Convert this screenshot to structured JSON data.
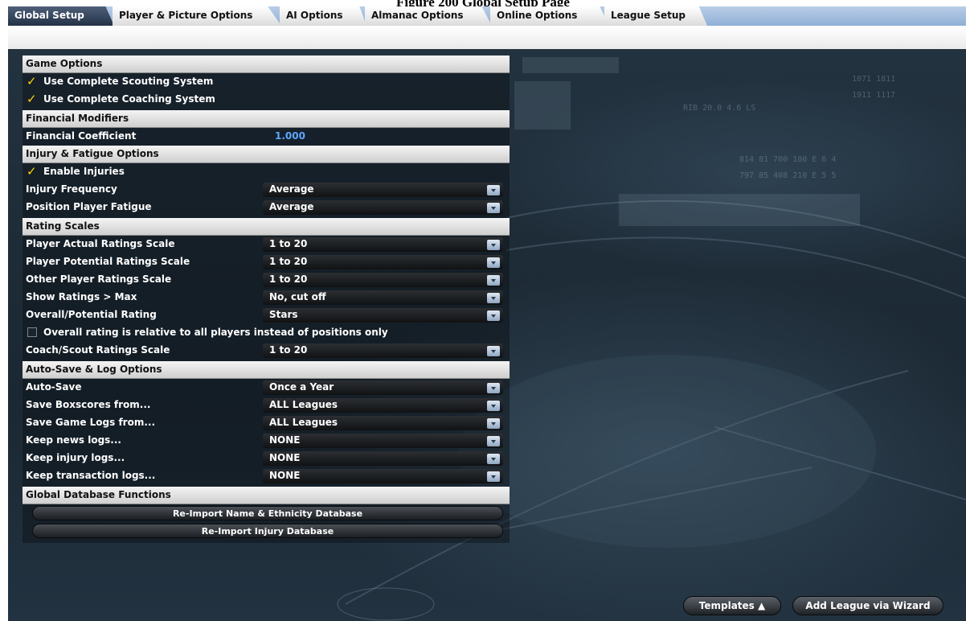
{
  "caption": "Figure 200 Global Setup Page",
  "tabs": [
    {
      "label": "Global Setup",
      "active": true
    },
    {
      "label": "Player & Picture Options"
    },
    {
      "label": "AI Options"
    },
    {
      "label": "Almanac Options"
    },
    {
      "label": "Online Options"
    },
    {
      "label": "League Setup"
    }
  ],
  "sections": {
    "game_options": {
      "title": "Game Options",
      "scouting": {
        "label": "Use Complete Scouting System",
        "checked": true
      },
      "coaching": {
        "label": "Use Complete Coaching System",
        "checked": true
      }
    },
    "financial": {
      "title": "Financial Modifiers",
      "coefficient_label": "Financial Coefficient",
      "coefficient_value": "1.000"
    },
    "injury": {
      "title": "Injury & Fatigue Options",
      "enable_injuries": {
        "label": "Enable Injuries",
        "checked": true
      },
      "frequency": {
        "label": "Injury Frequency",
        "value": "Average"
      },
      "fatigue": {
        "label": "Position Player Fatigue",
        "value": "Average"
      }
    },
    "ratings": {
      "title": "Rating Scales",
      "actual": {
        "label": "Player Actual Ratings Scale",
        "value": "1 to 20"
      },
      "potential": {
        "label": "Player Potential Ratings Scale",
        "value": "1 to 20"
      },
      "other": {
        "label": "Other Player Ratings Scale",
        "value": "1 to 20"
      },
      "show_max": {
        "label": "Show Ratings > Max",
        "value": "No, cut off"
      },
      "overall": {
        "label": "Overall/Potential Rating",
        "value": "Stars"
      },
      "relative": {
        "label": "Overall rating is relative to all players instead of positions only",
        "checked": false
      },
      "coach": {
        "label": "Coach/Scout Ratings Scale",
        "value": "1 to 20"
      }
    },
    "autosave": {
      "title": "Auto-Save & Log Options",
      "autosave": {
        "label": "Auto-Save",
        "value": "Once a Year"
      },
      "boxscores": {
        "label": "Save Boxscores from...",
        "value": "ALL Leagues"
      },
      "gamelogs": {
        "label": "Save Game Logs from...",
        "value": "ALL Leagues"
      },
      "news": {
        "label": "Keep news logs...",
        "value": "NONE"
      },
      "injury_logs": {
        "label": "Keep injury logs...",
        "value": "NONE"
      },
      "transaction": {
        "label": "Keep transaction logs...",
        "value": "NONE"
      }
    },
    "database": {
      "title": "Global Database Functions",
      "reimport_names": "Re-Import Name & Ethnicity Database",
      "reimport_injury": "Re-Import Injury Database"
    }
  },
  "footer": {
    "templates": "Templates ▲",
    "add_league": "Add League via Wizard"
  },
  "colors": {
    "accent_value": "#5da6ff",
    "checkmark": "#ffd400",
    "tabbar": "#8fb0d6"
  },
  "icons": [
    "checkmark-icon",
    "dropdown-arrow-icon"
  ]
}
